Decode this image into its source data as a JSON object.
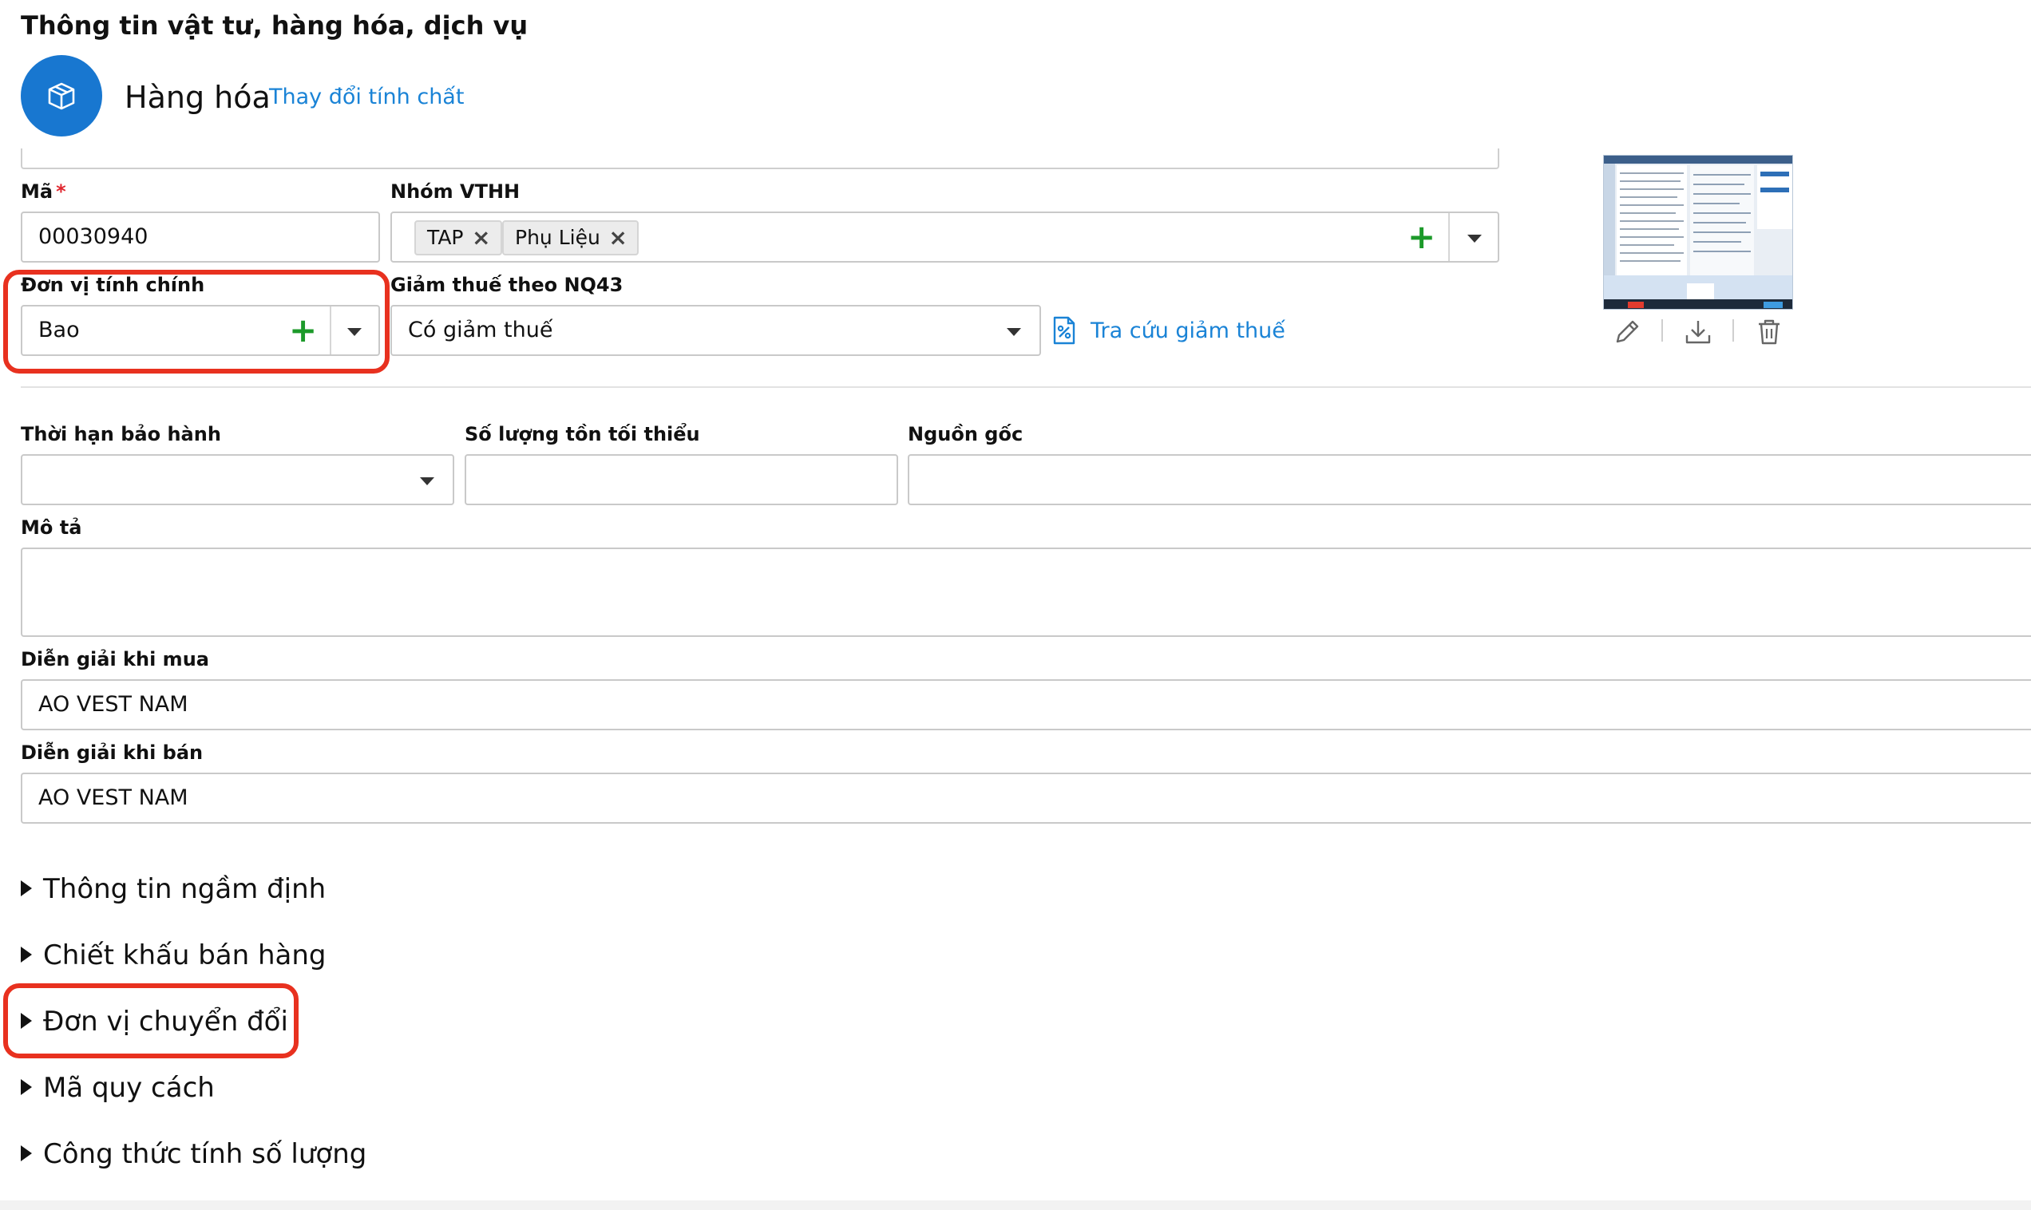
{
  "page": {
    "title": "Thông tin vật tư, hàng hóa, dịch vụ",
    "item_type": "Hàng hóa",
    "change_type_link": "Thay đổi tính chất"
  },
  "form": {
    "code": {
      "label": "Mã",
      "required_mark": "*",
      "value": "00030940"
    },
    "group": {
      "label": "Nhóm VTHH",
      "tags": [
        "TAP",
        "Phụ Liệu"
      ]
    },
    "unit": {
      "label": "Đơn vị tính chính",
      "value": "Bao"
    },
    "tax_reduction": {
      "label": "Giảm thuế theo NQ43",
      "value": "Có giảm thuế",
      "lookup_link": "Tra cứu giảm thuế"
    },
    "warranty": {
      "label": "Thời hạn bảo hành",
      "value": ""
    },
    "min_stock": {
      "label": "Số lượng tồn tối thiểu",
      "value": ""
    },
    "origin": {
      "label": "Nguồn gốc",
      "value": ""
    },
    "description": {
      "label": "Mô tả",
      "value": ""
    },
    "purchase_desc": {
      "label": "Diễn giải khi mua",
      "value": "AO VEST NAM"
    },
    "sale_desc": {
      "label": "Diễn giải khi bán",
      "value": "AO VEST NAM"
    }
  },
  "image_tools": [
    "pencil-icon",
    "download-icon",
    "trash-icon"
  ],
  "sections": [
    "Thông tin ngầm định",
    "Chiết khấu bán hàng",
    "Đơn vị chuyển đổi",
    "Mã quy cách",
    "Công thức tính số lượng"
  ],
  "colors": {
    "accent": "#1877d0",
    "link": "#1a83d6",
    "add_green": "#1c9a2a",
    "highlight_red": "#e8311f",
    "required_red": "#e0262e"
  }
}
